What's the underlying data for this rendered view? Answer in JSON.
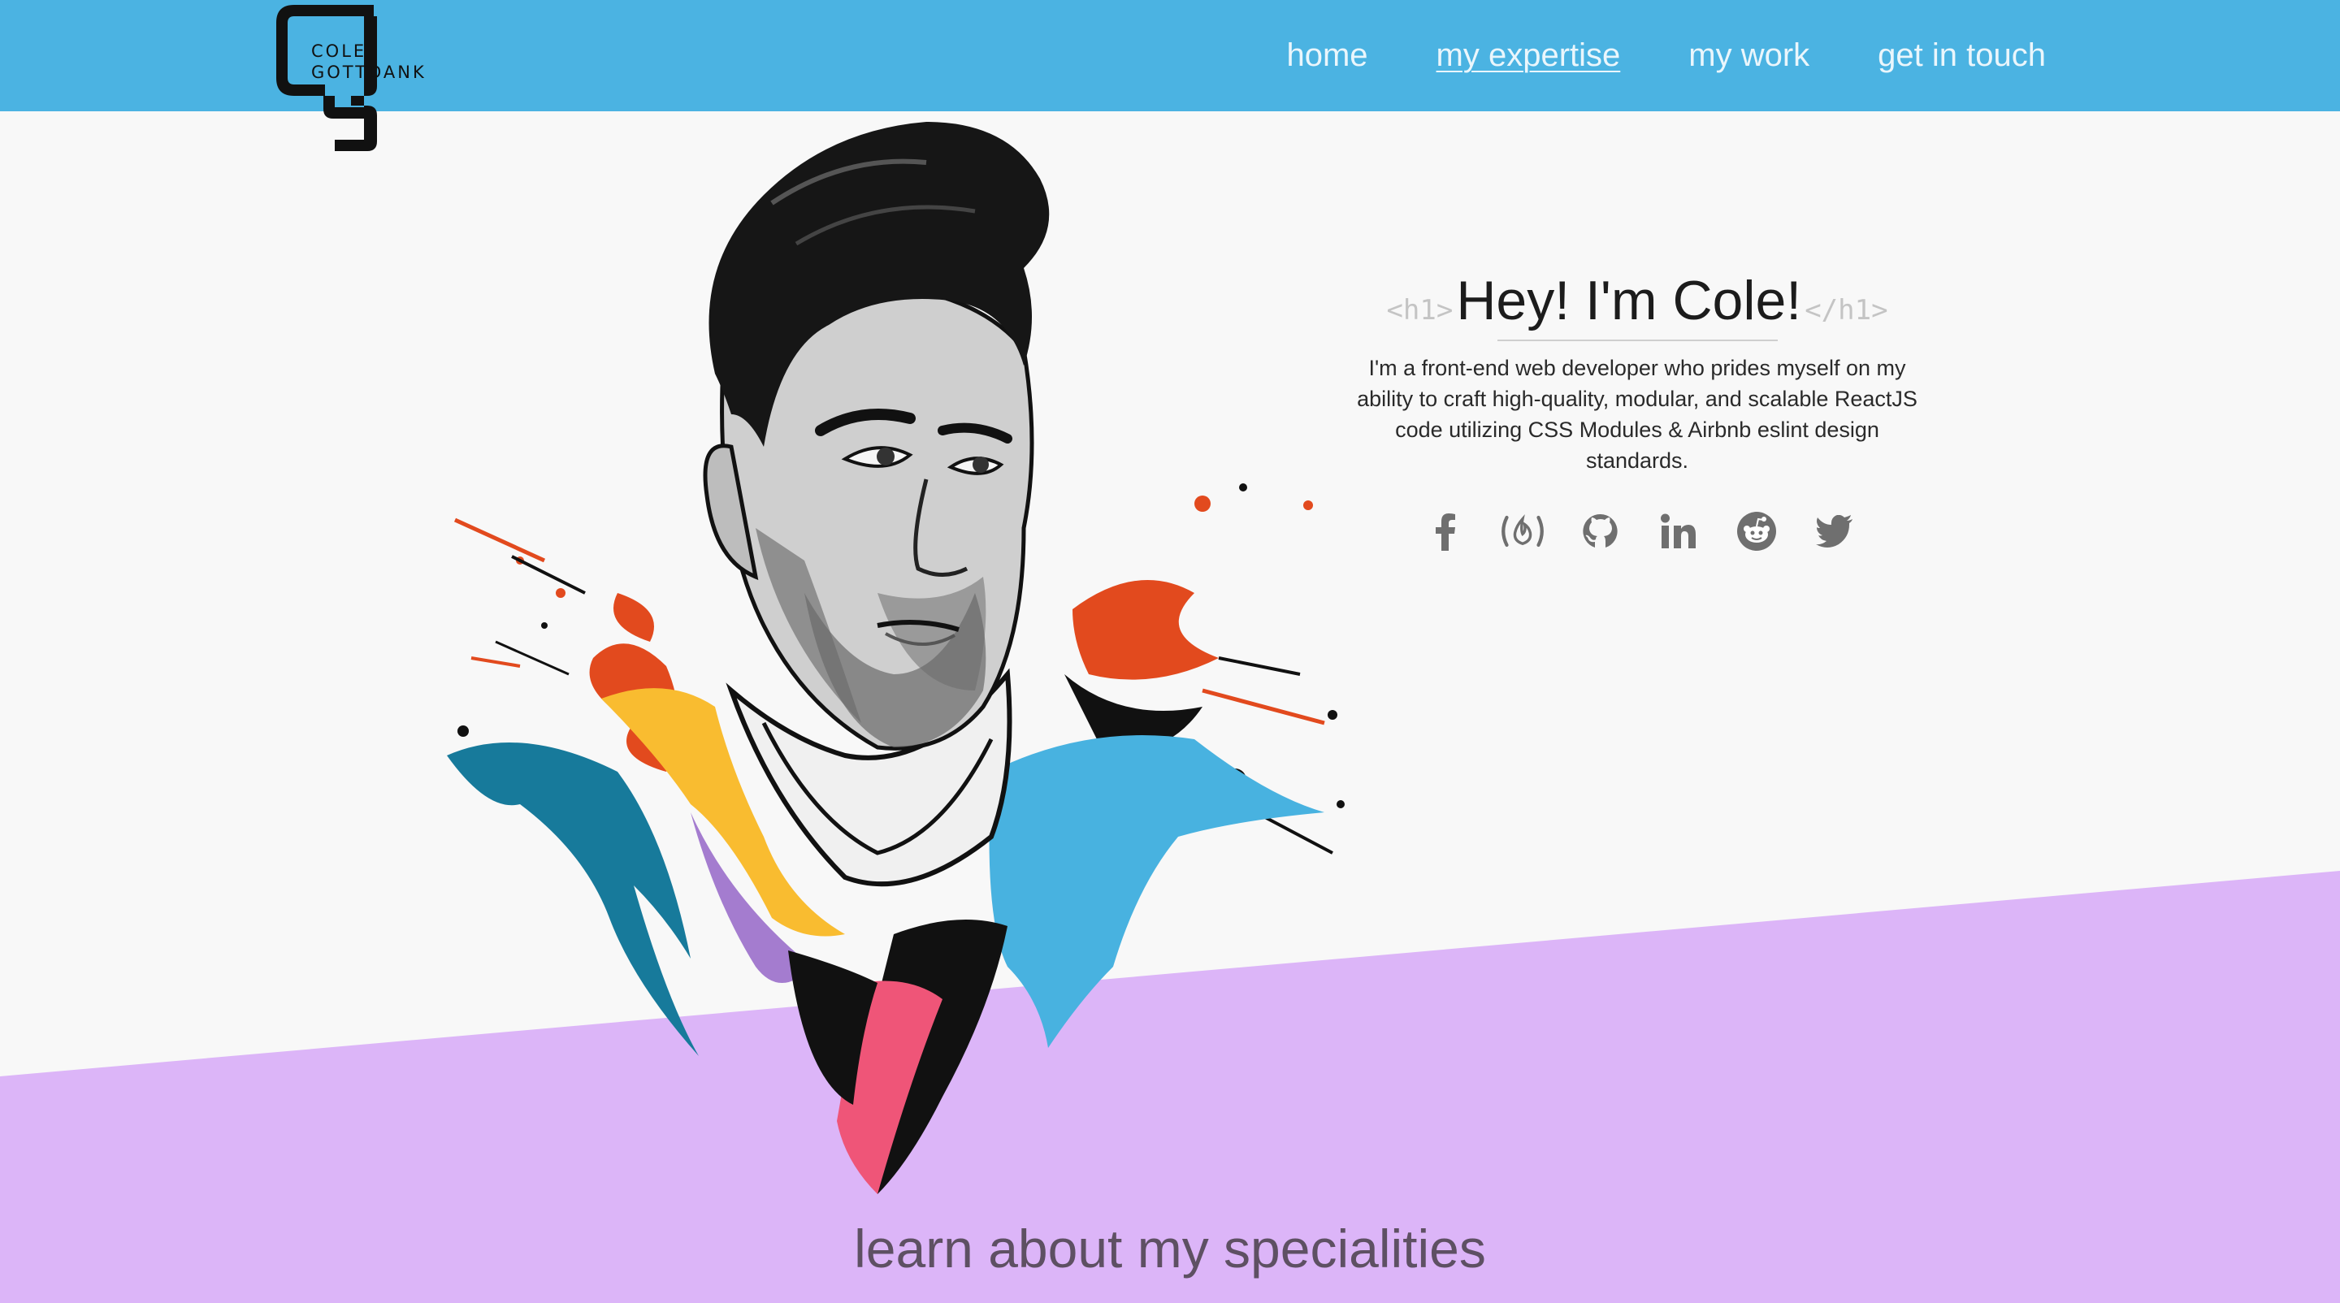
{
  "brand": {
    "logo_line1": "COLE",
    "logo_line2": "GOTTDANK"
  },
  "nav": {
    "items": [
      {
        "label": "home",
        "active": false
      },
      {
        "label": "my expertise",
        "active": true
      },
      {
        "label": "my work",
        "active": false
      },
      {
        "label": "get in touch",
        "active": false
      }
    ]
  },
  "hero": {
    "tag_open": "<h1>",
    "title": "Hey! I'm Cole!",
    "tag_close": "</h1>",
    "description": "I'm a front-end web developer who prides myself on my ability to craft high-quality, modular, and scalable ReactJS code utilizing CSS Modules & Airbnb eslint design standards."
  },
  "socials": [
    {
      "icon": "facebook-icon"
    },
    {
      "icon": "freecodecamp-icon"
    },
    {
      "icon": "github-icon"
    },
    {
      "icon": "linkedin-icon"
    },
    {
      "icon": "reddit-icon"
    },
    {
      "icon": "twitter-icon"
    }
  ],
  "section": {
    "heading": "learn about my specialities"
  },
  "colors": {
    "navbar": "#4bb3e2",
    "band": "#dcb5f8",
    "background": "#f8f8f8",
    "icon": "#6f6f6f"
  }
}
